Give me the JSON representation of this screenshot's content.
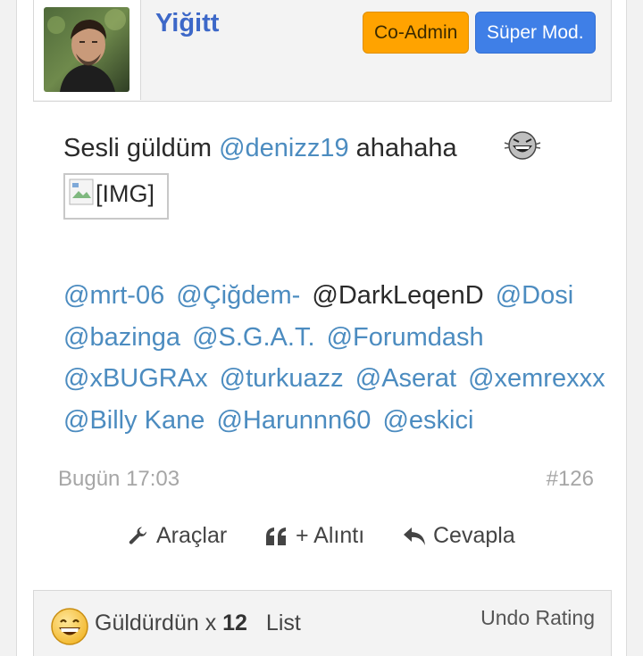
{
  "post": {
    "author": {
      "username": "Yiğitt",
      "badges": [
        {
          "label": "Co-Admin",
          "color": "#ffa300"
        },
        {
          "label": "Süper Mod.",
          "color": "#3f7fe7"
        }
      ]
    },
    "message": {
      "text_before": "Sesli güldüm ",
      "mention": "@denizz19",
      "text_after": " ahahaha",
      "emoji": "laughing-smiley",
      "image_placeholder": "[IMG]",
      "mention_list": [
        {
          "text": "@mrt-06",
          "linked": true
        },
        {
          "text": "@Çiğdem-",
          "linked": true
        },
        {
          "text": "@DarkLeqenD",
          "linked": false
        },
        {
          "text": "@Dosi",
          "linked": true
        },
        {
          "text": "@bazinga",
          "linked": true
        },
        {
          "text": "@S.G.A.T.",
          "linked": true
        },
        {
          "text": "@Forumdash",
          "linked": true
        },
        {
          "text": "@xBUGRAx",
          "linked": true
        },
        {
          "text": "@turkuazz",
          "linked": true
        },
        {
          "text": "@Aserat",
          "linked": true
        },
        {
          "text": "@xemrexxx",
          "linked": true
        },
        {
          "text": "@Billy Kane",
          "linked": true
        },
        {
          "text": "@Harunnn60",
          "linked": true
        },
        {
          "text": "@eskici",
          "linked": true
        }
      ]
    },
    "meta": {
      "date": "Bugün 17:03",
      "post_number": "#126"
    },
    "actions": {
      "tools": "Araçlar",
      "quote": "+ Alıntı",
      "reply": "Cevapla"
    },
    "rating": {
      "label": "Güldürdün x",
      "count": "12",
      "list": "List",
      "undo": "Undo Rating"
    }
  },
  "colors": {
    "mention": "#4c8cc0",
    "username": "#3d68c8",
    "meta": "#a6a6a6"
  }
}
